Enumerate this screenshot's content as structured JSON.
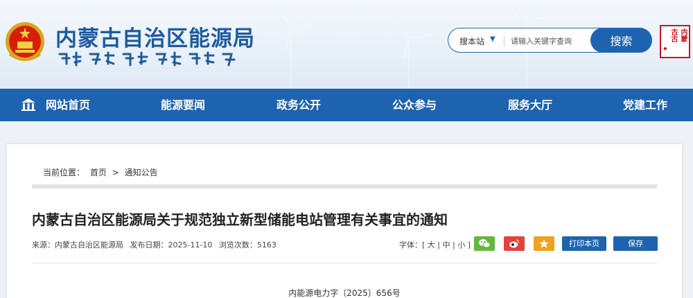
{
  "header": {
    "site_title": "内蒙古自治区能源局",
    "search": {
      "scope_label": "搜本站",
      "placeholder": "请输入关键字查询",
      "button_label": "搜索"
    },
    "emblem_icon": "national-emblem-icon",
    "seal_icon": "inner-mongolia-seal-icon"
  },
  "nav": {
    "items": [
      {
        "label": "网站首页",
        "icon": "home-icon"
      },
      {
        "label": "能源要闻"
      },
      {
        "label": "政务公开"
      },
      {
        "label": "公众参与"
      },
      {
        "label": "服务大厅"
      },
      {
        "label": "党建工作"
      }
    ]
  },
  "breadcrumb": {
    "prefix": "当前位置：",
    "home": "首页",
    "separator": ">",
    "current": "通知公告"
  },
  "article": {
    "title": "内蒙古自治区能源局关于规范独立新型储能电站管理有关事宜的通知",
    "source": "来源：内蒙古自治区能源局",
    "date": "发布日期：2025-11-10",
    "views": "浏览次数：5163",
    "font_label": "字体：[",
    "font_large": "大",
    "font_medium": "中",
    "font_small": "小",
    "font_sep": "|",
    "font_close": "]",
    "share_icons": [
      "wechat-icon",
      "weibo-icon",
      "favorite-star-icon"
    ],
    "print_label": "打印本页",
    "save_label": "保存",
    "doc_number": "内能源电力字〔2025〕656号"
  },
  "colors": {
    "brand_blue": "#1e63b0",
    "title_blue": "#1e5aa0",
    "wechat_green": "#63b83c",
    "weibo_red": "#e4413d",
    "star_orange": "#f0a21d",
    "seal_red": "#c8161d"
  }
}
